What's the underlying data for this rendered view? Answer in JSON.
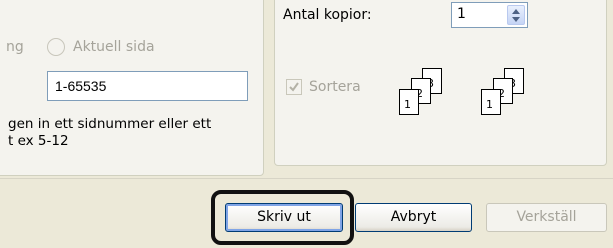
{
  "page_range": {
    "prev_option_partial": "ng",
    "current_page_option": "Aktuell sida",
    "pages_input_value": "1-65535",
    "hint_lines": [
      "gen in ett sidnummer eller ett",
      "t ex 5-12"
    ]
  },
  "copies": {
    "label": "Antal kopior:",
    "value": "1",
    "collate_label": "Sortera",
    "collate_checked": true,
    "stack_a": [
      "1",
      "2",
      "3"
    ],
    "stack_b": [
      "1",
      "2",
      "3"
    ]
  },
  "buttons": {
    "print": "Skriv ut",
    "cancel": "Avbryt",
    "apply": "Verkställ"
  },
  "colors": {
    "dialog_bg": "#ece9d8",
    "disabled_text": "#a5a39a",
    "input_border": "#7f9db9",
    "focus_outline": "#111111"
  }
}
